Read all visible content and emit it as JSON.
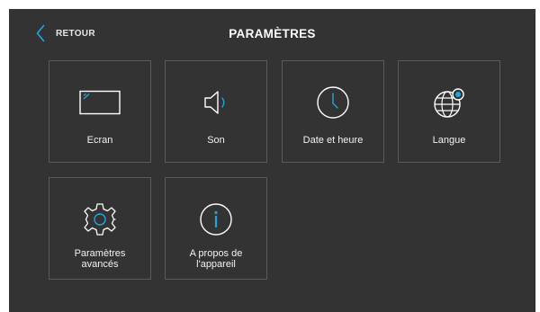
{
  "header": {
    "back_label": "RETOUR",
    "title": "PARAMÈTRES"
  },
  "tiles": [
    {
      "label": "Ecran",
      "icon": "screen-icon"
    },
    {
      "label": "Son",
      "icon": "speaker-icon"
    },
    {
      "label": "Date et heure",
      "icon": "clock-icon"
    },
    {
      "label": "Langue",
      "icon": "globe-icon"
    },
    {
      "label_line1": "Paramètres",
      "label_line2": "avancés",
      "icon": "gear-icon"
    },
    {
      "label_line1": "A propos de",
      "label_line2": "l'appareil",
      "icon": "info-icon"
    }
  ],
  "colors": {
    "background": "#333333",
    "tile_border": "#5a5a5a",
    "accent": "#1ea7e1",
    "text": "#ffffff"
  }
}
